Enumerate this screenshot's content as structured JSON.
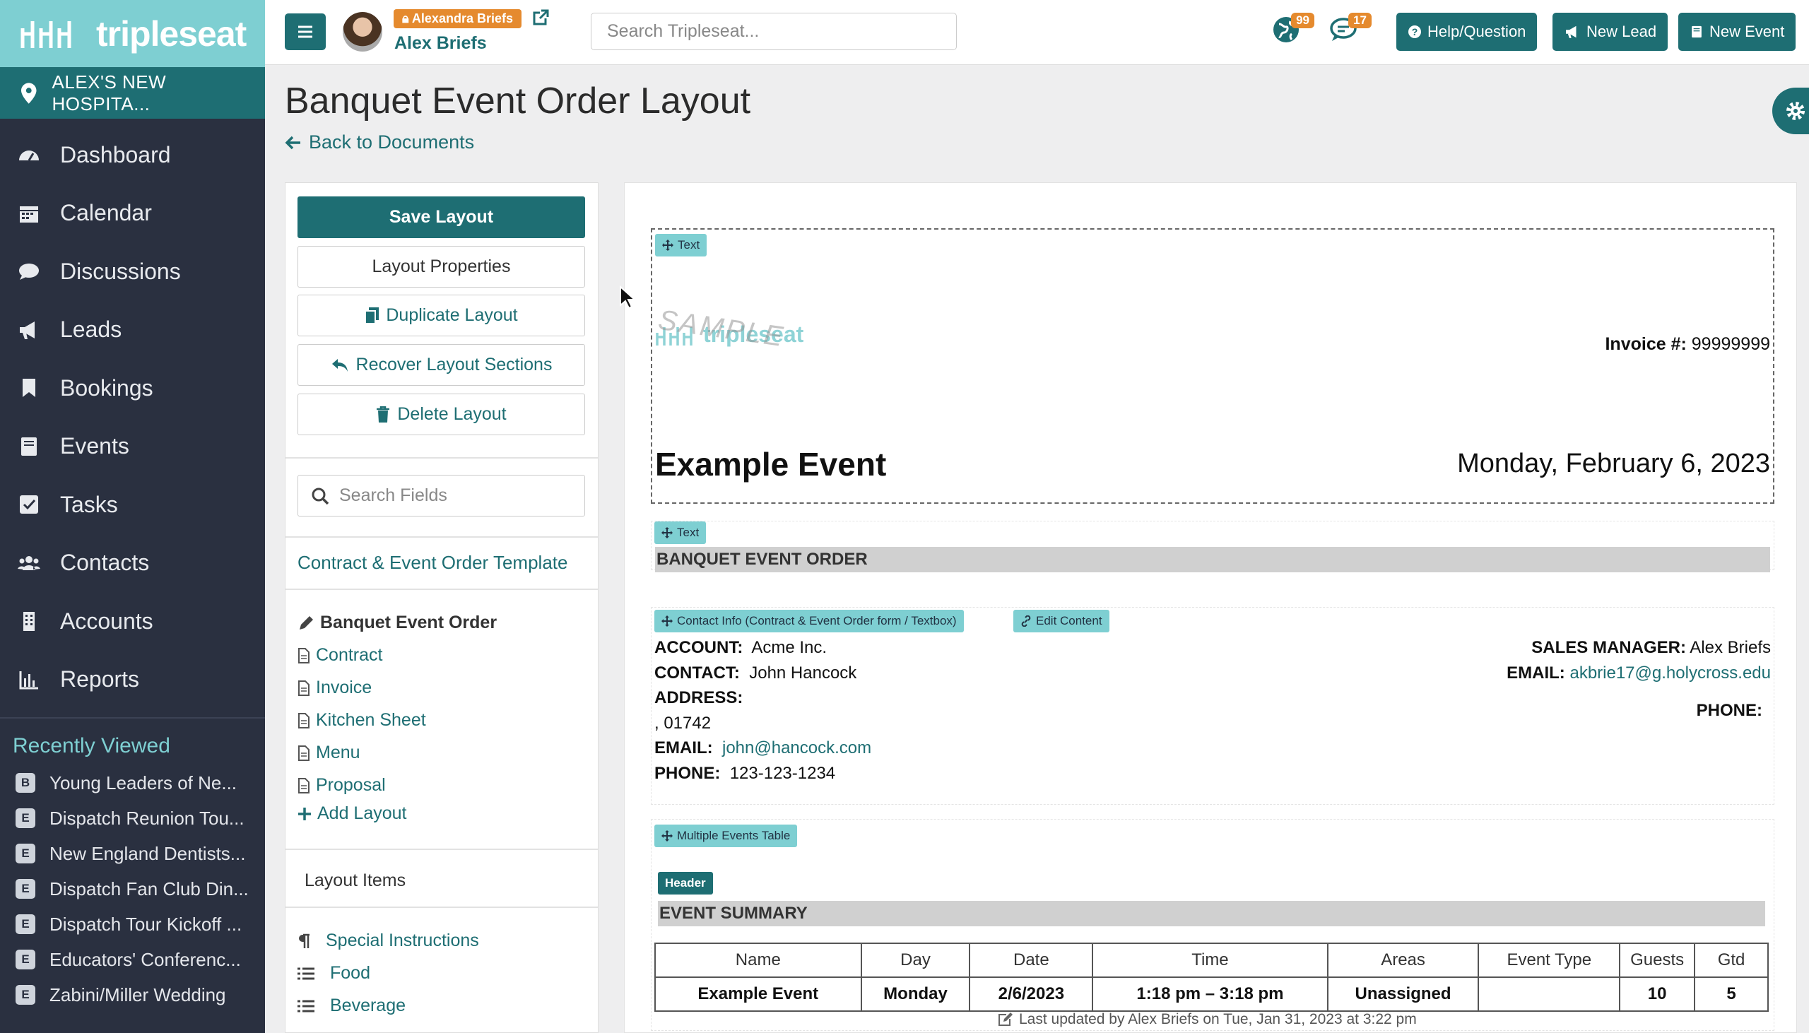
{
  "brand": {
    "name": "tripleseat",
    "teal": "#1e6e73",
    "light_teal": "#7ecfd2",
    "orange": "#e58a2e",
    "sidebar_bg": "#2a3040"
  },
  "sidebar": {
    "location": "ALEX'S NEW HOSPITA...",
    "items": [
      {
        "label": "Dashboard",
        "icon": "dashboard-icon"
      },
      {
        "label": "Calendar",
        "icon": "calendar-icon"
      },
      {
        "label": "Discussions",
        "icon": "comment-icon"
      },
      {
        "label": "Leads",
        "icon": "megaphone-icon"
      },
      {
        "label": "Bookings",
        "icon": "bookmark-icon"
      },
      {
        "label": "Events",
        "icon": "book-icon"
      },
      {
        "label": "Tasks",
        "icon": "checkbox-icon"
      },
      {
        "label": "Contacts",
        "icon": "users-icon"
      },
      {
        "label": "Accounts",
        "icon": "building-icon"
      },
      {
        "label": "Reports",
        "icon": "bar-chart-icon"
      }
    ],
    "recently_viewed_title": "Recently Viewed",
    "recent": [
      {
        "badge": "B",
        "label": "Young Leaders of Ne..."
      },
      {
        "badge": "E",
        "label": "Dispatch Reunion Tou..."
      },
      {
        "badge": "E",
        "label": "New England Dentists..."
      },
      {
        "badge": "E",
        "label": "Dispatch Fan Club Din..."
      },
      {
        "badge": "E",
        "label": "Dispatch Tour Kickoff ..."
      },
      {
        "badge": "E",
        "label": "Educators' Conferenc..."
      },
      {
        "badge": "E",
        "label": "Zabini/Miller Wedding"
      }
    ]
  },
  "topbar": {
    "impersonating": "Alexandra Briefs",
    "user": "Alex Briefs",
    "search_placeholder": "Search Tripleseat...",
    "notifications": {
      "globe": "99",
      "messages": "17"
    },
    "help": "Help/Question",
    "new_lead": "New Lead",
    "new_event": "New Event"
  },
  "page": {
    "title": "Banquet Event Order Layout",
    "back": "Back to Documents"
  },
  "panel": {
    "save": "Save Layout",
    "properties": "Layout Properties",
    "duplicate": "Duplicate Layout",
    "recover": "Recover Layout Sections",
    "delete": "Delete Layout",
    "search_placeholder": "Search Fields",
    "template": "Contract & Event Order Template",
    "documents": [
      "Banquet Event Order",
      "Contract",
      "Invoice",
      "Kitchen Sheet",
      "Menu",
      "Proposal"
    ],
    "add_layout": "Add Layout",
    "layout_items_title": "Layout Items",
    "layout_items": [
      {
        "label": "Special Instructions",
        "icon": "paragraph-icon"
      },
      {
        "label": "Food",
        "icon": "list-icon"
      },
      {
        "label": "Beverage",
        "icon": "list-icon"
      }
    ]
  },
  "doc": {
    "tag_text": "Text",
    "sample_logo": "SAMPLE",
    "logo_word": "tripleseat",
    "invoice_label": "Invoice #:",
    "invoice_no": "99999999",
    "event_name": "Example Event",
    "event_date": "Monday, February 6, 2023",
    "beo_title": "BANQUET EVENT ORDER",
    "contact_tag": "Contact Info (Contract & Event Order form / Textbox)",
    "edit_content": "Edit Content",
    "account_label": "ACCOUNT:",
    "account": "Acme Inc.",
    "contact_label": "CONTACT:",
    "contact": "John Hancock",
    "address_label": "ADDRESS:",
    "address": ", 01742",
    "email_label": "EMAIL:",
    "email": "john@hancock.com",
    "phone_label": "PHONE:",
    "phone": "123-123-1234",
    "sales_manager_label": "SALES MANAGER:",
    "sales_manager": "Alex Briefs",
    "sm_email_label": "EMAIL:",
    "sm_email": "akbrie17@g.holycross.edu",
    "sm_phone_label": "PHONE:",
    "events_table_tag": "Multiple Events Table",
    "header_tag": "Header",
    "summary_title": "EVENT SUMMARY",
    "table": {
      "headers": [
        "Name",
        "Day",
        "Date",
        "Time",
        "Areas",
        "Event Type",
        "Guests",
        "Gtd"
      ],
      "rows": [
        [
          "Example Event",
          "Monday",
          "2/6/2023",
          "1:18 pm – 3:18 pm",
          "Unassigned",
          "",
          "10",
          "5"
        ]
      ]
    },
    "last_updated": "Last updated by Alex Briefs on Tue, Jan 31, 2023 at 3:22 pm"
  }
}
